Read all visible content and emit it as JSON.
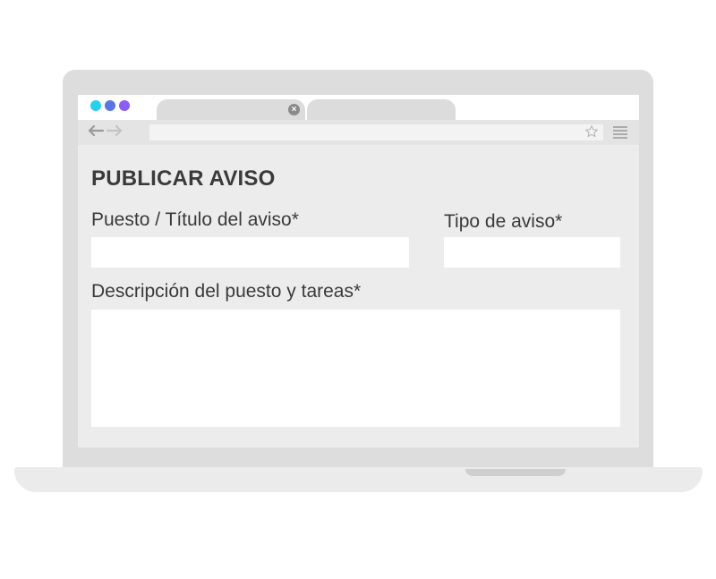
{
  "page": {
    "title": "PUBLICAR AVISO",
    "fields": {
      "job_title_label": "Puesto / Título del aviso*",
      "job_title_value": "",
      "ad_type_label": "Tipo de aviso*",
      "ad_type_value": "",
      "description_label": "Descripción del puesto y tareas*",
      "description_value": ""
    }
  },
  "browser": {
    "address_value": "",
    "icons": [
      "back-arrow-icon",
      "forward-arrow-icon",
      "close-icon",
      "star-icon",
      "menu-icon"
    ],
    "window_dot_colors": [
      "#22d3ee",
      "#5b73e8",
      "#8b5cf6"
    ]
  },
  "colors": {
    "screen_bg": "#ececec",
    "text": "#3a3a3a",
    "device": "#dddddd"
  }
}
